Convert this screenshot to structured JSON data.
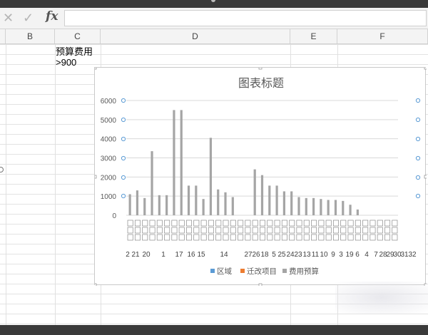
{
  "formula_bar": {
    "fx_label": "fx",
    "cancel_icon": "close-icon",
    "confirm_icon": "check-icon",
    "value": ""
  },
  "columns": [
    "B",
    "C",
    "D",
    "E",
    "F"
  ],
  "cells": {
    "c1": "预算费用",
    "c2": ">900"
  },
  "colors": {
    "series_region": "#5b9bd5",
    "series_changed": "#ed7d31",
    "series_budget": "#a5a5a5"
  },
  "chart_data": {
    "type": "bar",
    "title": "图表标题",
    "ylim": [
      0,
      6000
    ],
    "yticks": [
      "0",
      "1000",
      "2000",
      "3000",
      "4000",
      "5000",
      "6000"
    ],
    "grid": true,
    "legend_position": "bottom",
    "series": [
      {
        "name": "区域",
        "values": []
      },
      {
        "name": "迁改项目",
        "values": []
      },
      {
        "name": "费用预算",
        "values": [
          1100,
          1300,
          900,
          3350,
          1050,
          1050,
          5500,
          5500,
          1550,
          1550,
          850,
          4050,
          1350,
          1200,
          950,
          null,
          null,
          2400,
          2100,
          1550,
          1550,
          1250,
          1250,
          950,
          900,
          900,
          850,
          800,
          800,
          750,
          550,
          300,
          null,
          null,
          null,
          null,
          null
        ]
      }
    ],
    "category_codes": [
      "2",
      "21",
      "20",
      "1",
      "17",
      "16",
      "15",
      "14",
      "27",
      "26",
      "18",
      "5",
      "25",
      "24",
      "23",
      "13",
      "11",
      "10",
      "9",
      "3",
      "19",
      "6",
      "4",
      "7",
      "28",
      "29",
      "30",
      "31",
      "32"
    ]
  }
}
